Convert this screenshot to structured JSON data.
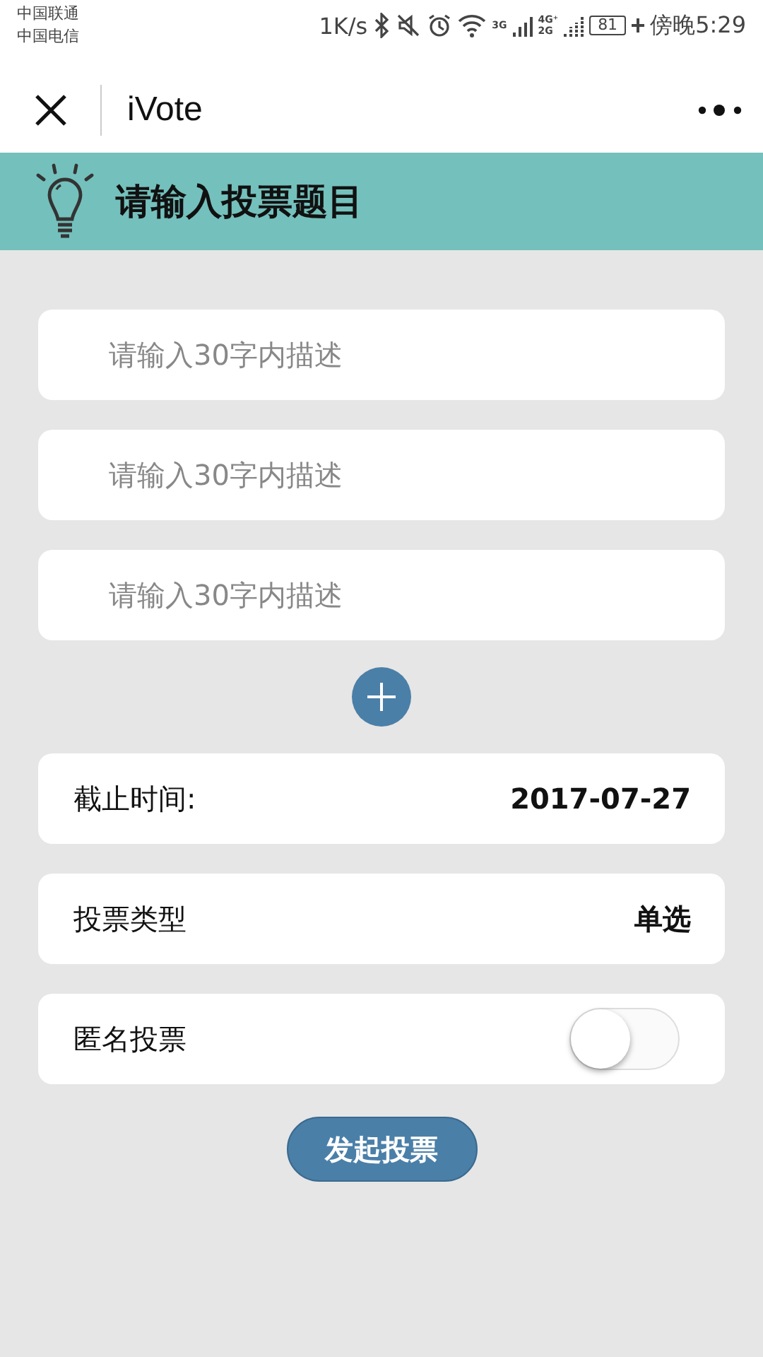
{
  "status_bar": {
    "carriers": [
      "中国联通",
      "中国电信"
    ],
    "speed": "1K/s",
    "network_labels": [
      "3G",
      "4G⁺",
      "2G"
    ],
    "battery": "81",
    "time": "傍晚5:29"
  },
  "nav": {
    "title": "iVote"
  },
  "banner": {
    "title": "请输入投票题目"
  },
  "options": [
    {
      "placeholder": "请输入30字内描述"
    },
    {
      "placeholder": "请输入30字内描述"
    },
    {
      "placeholder": "请输入30字内描述"
    }
  ],
  "settings": [
    {
      "kind": "value",
      "label": "截止时间:",
      "value": "2017-07-27"
    },
    {
      "kind": "value",
      "label": "投票类型",
      "value": "单选"
    },
    {
      "kind": "toggle",
      "label": "匿名投票",
      "on": false
    }
  ],
  "submit": "发起投票"
}
